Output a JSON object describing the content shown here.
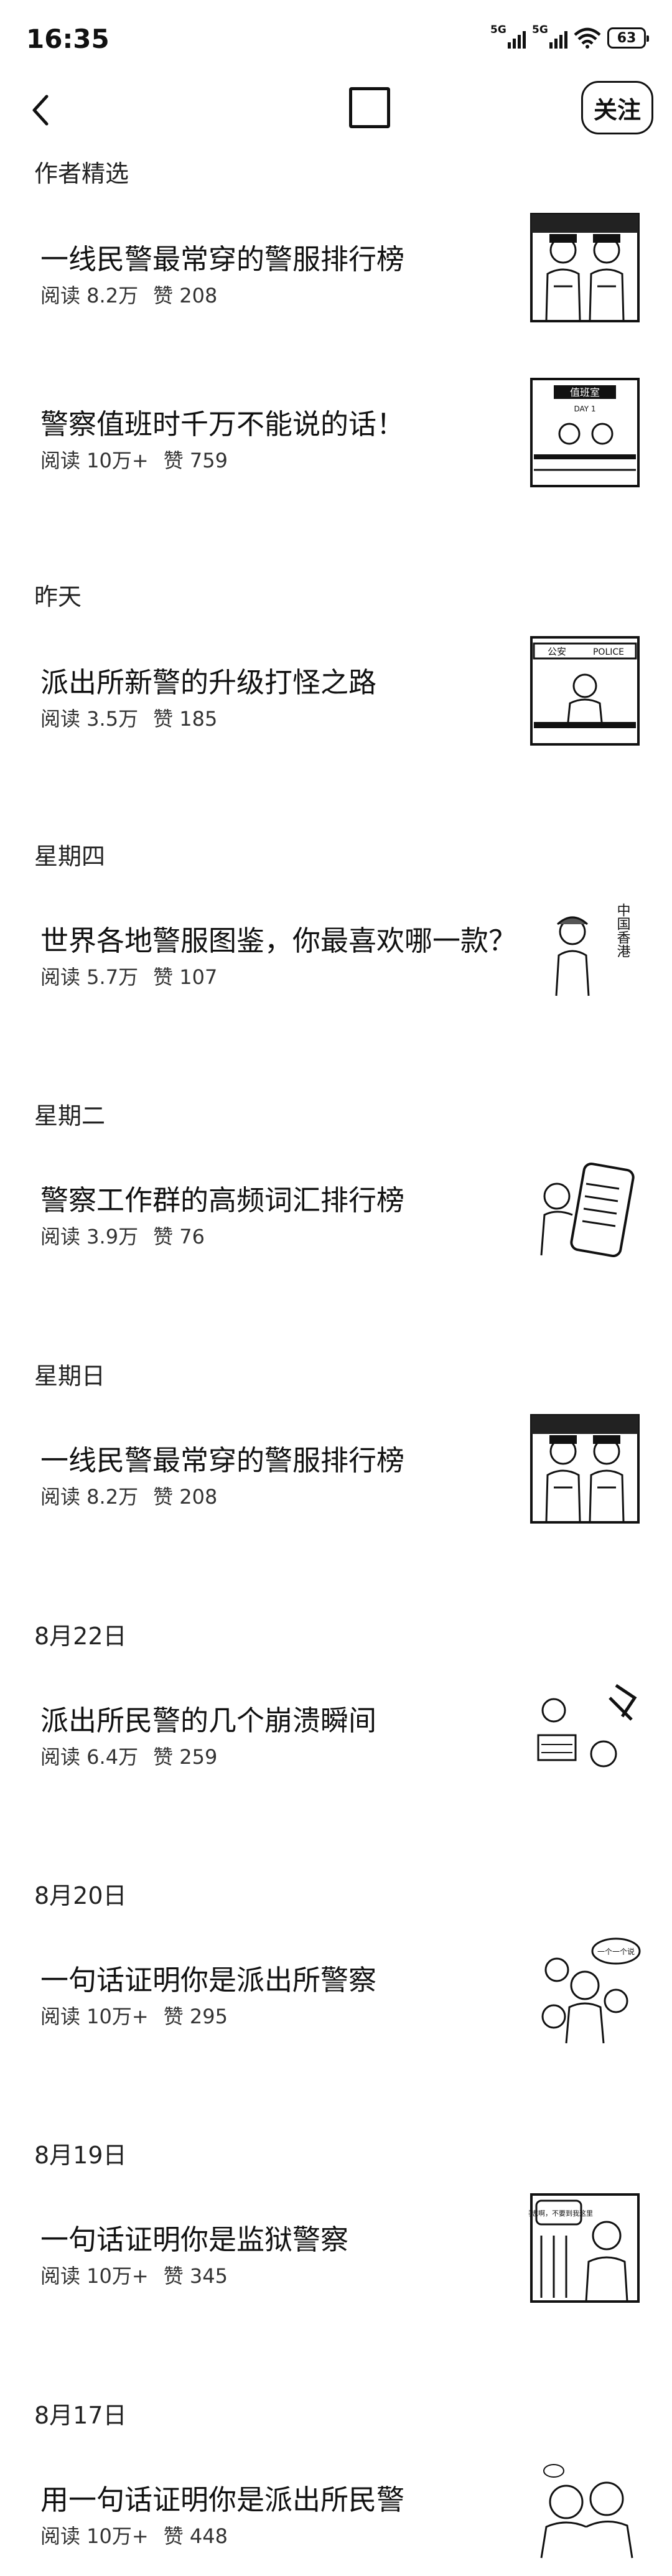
{
  "status_bar": {
    "time": "16:35",
    "network_1": "5G",
    "network_2": "5G",
    "battery": "63"
  },
  "nav": {
    "follow_label": "关注"
  },
  "sections": [
    {
      "title": "作者精选",
      "articles": [
        {
          "title": "一线民警最常穿的警服排行榜",
          "reads": "阅读 8.2万",
          "likes": "赞 208"
        },
        {
          "title": "警察值班时千万不能说的话！",
          "reads": "阅读 10万+",
          "likes": "赞 759"
        }
      ]
    },
    {
      "title": "昨天",
      "articles": [
        {
          "title": "派出所新警的升级打怪之路",
          "reads": "阅读 3.5万",
          "likes": "赞 185"
        }
      ]
    },
    {
      "title": "星期四",
      "articles": [
        {
          "title": "世界各地警服图鉴，你最喜欢哪一款？",
          "reads": "阅读 5.7万",
          "likes": "赞 107"
        }
      ]
    },
    {
      "title": "星期二",
      "articles": [
        {
          "title": "警察工作群的高频词汇排行榜",
          "reads": "阅读 3.9万",
          "likes": "赞 76"
        }
      ]
    },
    {
      "title": "星期日",
      "articles": [
        {
          "title": "一线民警最常穿的警服排行榜",
          "reads": "阅读 8.2万",
          "likes": "赞 208"
        }
      ]
    },
    {
      "title": "8月22日",
      "articles": [
        {
          "title": "派出所民警的几个崩溃瞬间",
          "reads": "阅读 6.4万",
          "likes": "赞 259"
        }
      ]
    },
    {
      "title": "8月20日",
      "articles": [
        {
          "title": "一句话证明你是派出所警察",
          "reads": "阅读 10万+",
          "likes": "赞 295"
        }
      ]
    },
    {
      "title": "8月19日",
      "articles": [
        {
          "title": "一句话证明你是监狱警察",
          "reads": "阅读 10万+",
          "likes": "赞 345"
        }
      ]
    },
    {
      "title": "8月17日",
      "articles": [
        {
          "title": "用一句话证明你是派出所民警",
          "reads": "阅读 10万+",
          "likes": "赞 448"
        }
      ]
    }
  ],
  "thumbnails": {
    "board_sign": "值班室",
    "board_day": "DAY 1",
    "station_sign": "公安",
    "station_sign_en": "POLICE",
    "hk_caption": "中国香港",
    "speech_1": "一个一个说",
    "speech_2": "同志啊，不要到我这里"
  }
}
